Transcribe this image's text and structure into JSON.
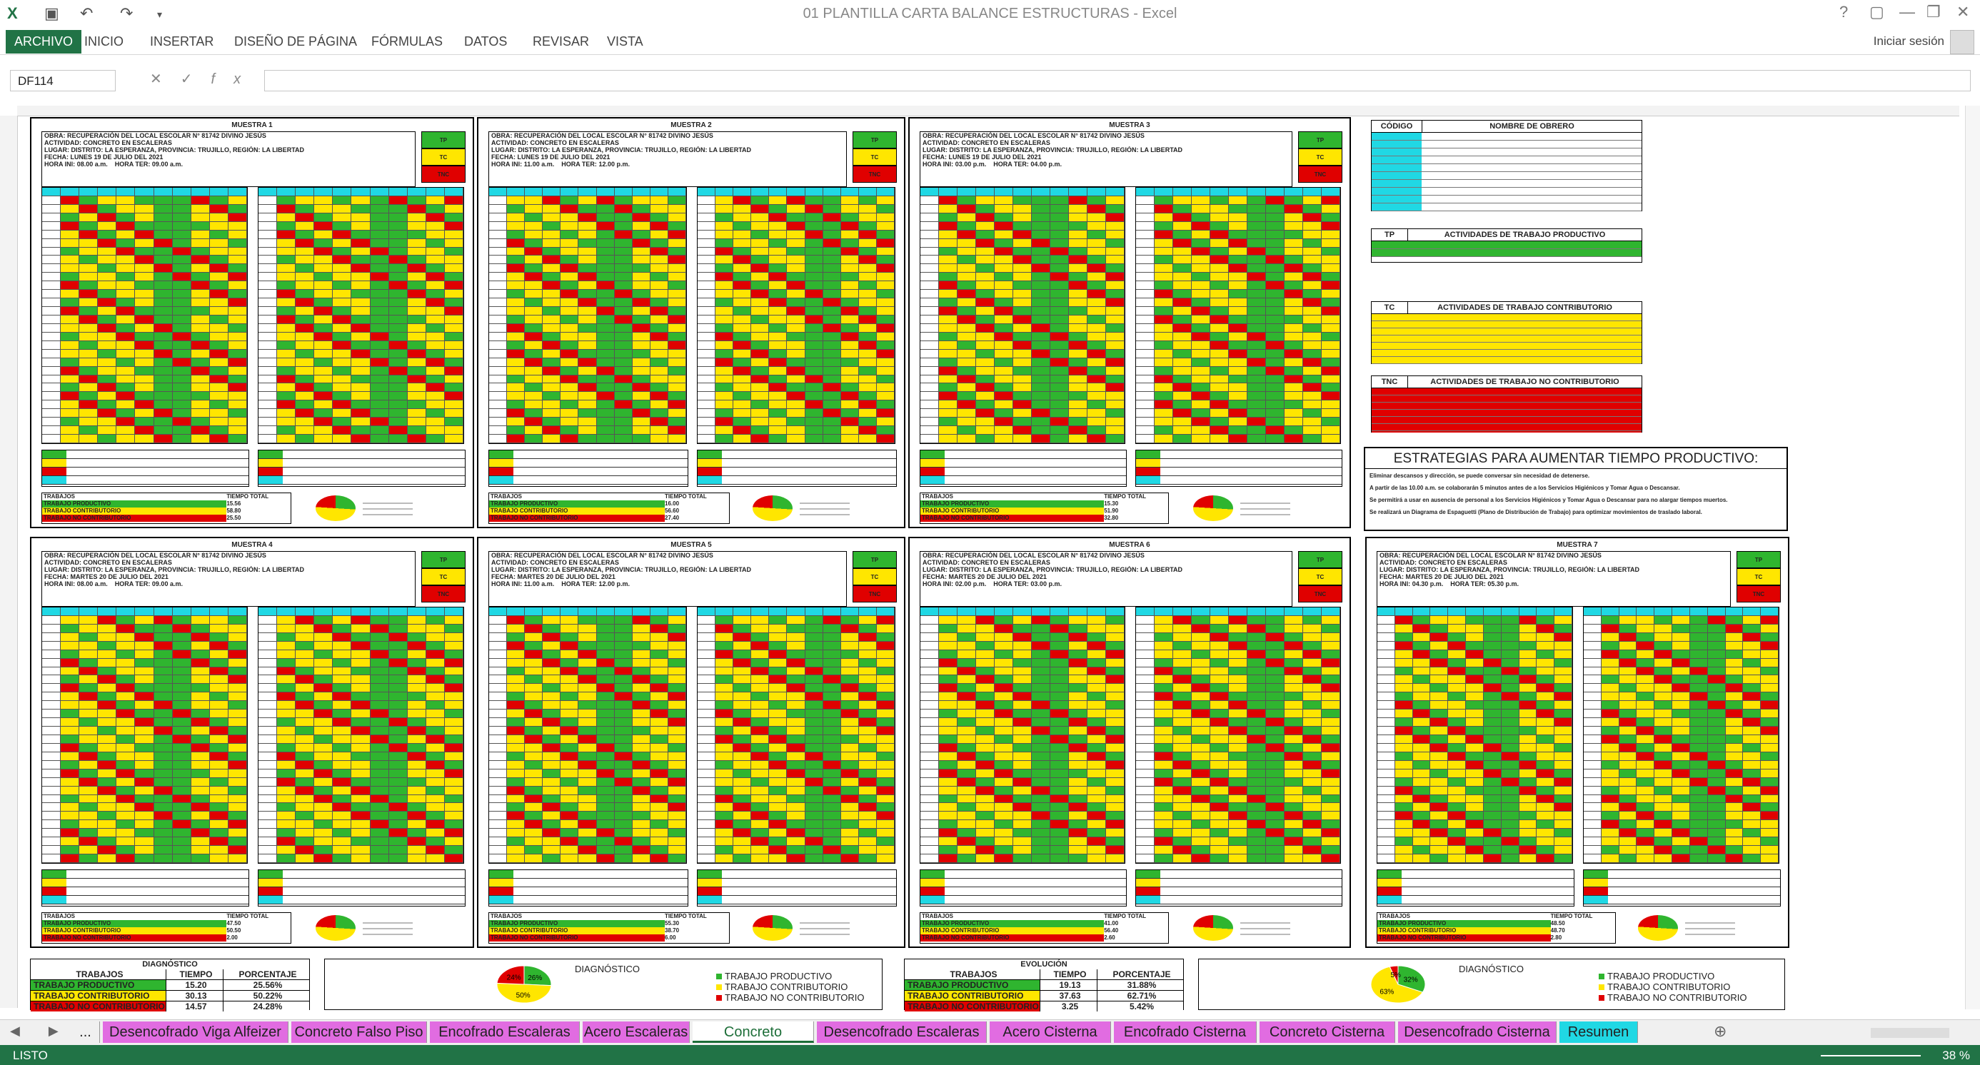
{
  "window": {
    "title": "01 PLANTILLA CARTA BALANCE ESTRUCTURAS - Excel",
    "controls": [
      "?",
      "▢",
      "—",
      "❐",
      "✕"
    ]
  },
  "ribbon": {
    "tabs": [
      "ARCHIVO",
      "INICIO",
      "INSERTAR",
      "DISEÑO DE PÁGINA",
      "FÓRMULAS",
      "DATOS",
      "REVISAR",
      "VISTA"
    ],
    "signin": "Iniciar sesión"
  },
  "formula_bar": {
    "name_box": "DF114",
    "fx": "fx",
    "value": ""
  },
  "samples": [
    {
      "title": "MUESTRA 1",
      "x": 0,
      "fecha": "LUNES 19 DE JULIO DEL 2021",
      "hora_ini": "08.00 a.m.",
      "hora_ter": "09.00 a.m.",
      "prod": "15.56",
      "cont": "58.80",
      "nocont": "25.50"
    },
    {
      "title": "MUESTRA 2",
      "fecha": "LUNES 19 DE JULIO DEL 2021",
      "hora_ini": "11.00 a.m.",
      "hora_ter": "12.00 p.m.",
      "prod": "16.00",
      "cont": "56.60",
      "nocont": "27.40"
    },
    {
      "title": "MUESTRA 3",
      "fecha": "LUNES 19 DE JULIO DEL 2021",
      "hora_ini": "03.00 p.m.",
      "hora_ter": "04.00 p.m.",
      "prod": "15.30",
      "cont": "51.90",
      "nocont": "32.80"
    },
    {
      "title": "MUESTRA 4",
      "fecha": "MARTES 20 DE JULIO DEL 2021",
      "hora_ini": "08.00 a.m.",
      "hora_ter": "09.00 a.m.",
      "prod": "47.50",
      "cont": "50.50",
      "nocont": "2.00"
    },
    {
      "title": "MUESTRA 5",
      "fecha": "MARTES 20 DE JULIO DEL 2021",
      "hora_ini": "11.00 a.m.",
      "hora_ter": "12.00 p.m.",
      "prod": "55.30",
      "cont": "38.70",
      "nocont": "6.00"
    },
    {
      "title": "MUESTRA 6",
      "fecha": "MARTES 20 DE JULIO DEL 2021",
      "hora_ini": "02.00 p.m.",
      "hora_ter": "03.00 p.m.",
      "prod": "41.00",
      "cont": "56.40",
      "nocont": "2.60"
    },
    {
      "title": "MUESTRA 7",
      "fecha": "MARTES 20 DE JULIO DEL 2021",
      "hora_ini": "04.30 p.m.",
      "hora_ter": "05.30 p.m.",
      "prod": "48.50",
      "cont": "48.70",
      "nocont": "2.80"
    }
  ],
  "info_labels": {
    "obra": "OBRA:",
    "actividad": "ACTIVIDAD:",
    "lugar": "LUGAR:",
    "fecha": "FECHA:",
    "hora_ini": "HORA INI:",
    "hora_ter": "HORA TER:",
    "obra_val": "RECUPERACIÓN DEL LOCAL ESCOLAR N° 81742 DIVINO JESÚS",
    "actividad_val": "CONCRETO EN ESCALERAS",
    "lugar_val": "DISTRITO: LA ESPERANZA, PROVINCIA: TRUJILLO, REGIÓN: LA LIBERTAD"
  },
  "categories": {
    "tp": "TP",
    "tc": "TC",
    "tnc": "TNC"
  },
  "summary_labels": {
    "trabajos": "TRABAJOS",
    "tiempo_total": "TIEMPO TOTAL",
    "productivo": "TRABAJO PRODUCTIVO",
    "contributorio": "TRABAJO CONTRIBUTORIO",
    "no_contributorio": "TRABAJO NO CONTRIBUTORIO"
  },
  "legend": {
    "codigo": "CÓDIGO",
    "nombre": "NOMBRE DE OBRERO",
    "tp_title": "ACTIVIDADES DE TRABAJO PRODUCTIVO",
    "tc_title": "ACTIVIDADES DE TRABAJO CONTRIBUTORIO",
    "tnc_title": "ACTIVIDADES DE TRABAJO NO CONTRIBUTORIO"
  },
  "strategies": {
    "title": "ESTRATEGIAS PARA AUMENTAR TIEMPO PRODUCTIVO:",
    "lines": [
      "Eliminar descansos y dirección, se puede conversar sin necesidad de detenerse.",
      "A partir de las 10.00 a.m. se colaborarán 5 minutos antes de a los Servicios Higiénicos y Tomar Agua o Descansar.",
      "Se permitirá a usar en ausencia de personal a los Servicios Higiénicos y Tomar Agua o Descansar para no alargar tiempos muertos.",
      "Se realizará un Diagrama de Espaguetti (Plano de Distribución de Trabajo) para optimizar movimientos de traslado laboral."
    ]
  },
  "diagnostico1": {
    "title": "DIAGNÓSTICO",
    "headers": [
      "TRABAJOS",
      "TIEMPO",
      "PORCENTAJE"
    ],
    "rows": [
      {
        "label": "TRABAJO PRODUCTIVO",
        "tiempo": "15.20",
        "pct": "25.56%"
      },
      {
        "label": "TRABAJO CONTRIBUTORIO",
        "tiempo": "30.13",
        "pct": "50.22%"
      },
      {
        "label": "TRABAJO NO CONTRIBUTORIO",
        "tiempo": "14.57",
        "pct": "24.28%"
      }
    ]
  },
  "evolucion": {
    "title": "EVOLUCIÓN",
    "headers": [
      "TRABAJOS",
      "TIEMPO",
      "PORCENTAJE"
    ],
    "rows": [
      {
        "label": "TRABAJO PRODUCTIVO",
        "tiempo": "19.13",
        "pct": "31.88%"
      },
      {
        "label": "TRABAJO CONTRIBUTORIO",
        "tiempo": "37.63",
        "pct": "62.71%"
      },
      {
        "label": "TRABAJO NO CONTRIBUTORIO",
        "tiempo": "3.25",
        "pct": "5.42%"
      }
    ]
  },
  "chart_data": [
    {
      "type": "pie",
      "title": "DIAGNÓSTICO",
      "categories": [
        "TRABAJO PRODUCTIVO",
        "TRABAJO CONTRIBUTORIO",
        "TRABAJO NO CONTRIBUTORIO"
      ],
      "values": [
        26,
        50,
        24
      ],
      "labels": [
        "26%",
        "50%",
        "24%"
      ]
    },
    {
      "type": "pie",
      "title": "DIAGNÓSTICO",
      "categories": [
        "TRABAJO PRODUCTIVO",
        "TRABAJO CONTRIBUTORIO",
        "TRABAJO NO CONTRIBUTORIO"
      ],
      "values": [
        32,
        63,
        5
      ],
      "labels": [
        "32%",
        "63%",
        "5%"
      ]
    }
  ],
  "colors": {
    "tp": "#2fb52f",
    "tc": "#ffe600",
    "tnc": "#e00000",
    "cyan": "#20d8e4",
    "excel_green": "#217346"
  },
  "sheet_tabs": [
    {
      "label": "...",
      "active": false
    },
    {
      "label": "Desencofrado Viga Alfeizer",
      "active": false
    },
    {
      "label": "Concreto Falso Piso",
      "active": false
    },
    {
      "label": "Encofrado Escaleras",
      "active": false
    },
    {
      "label": "Acero Escaleras",
      "active": false
    },
    {
      "label": "Concreto Escaleras",
      "active": true
    },
    {
      "label": "Desencofrado Escaleras",
      "active": false
    },
    {
      "label": "Acero Cisterna",
      "active": false
    },
    {
      "label": "Encofrado Cisterna",
      "active": false
    },
    {
      "label": "Concreto Cisterna",
      "active": false
    },
    {
      "label": "Desencofrado Cisterna",
      "active": false
    },
    {
      "label": "Resumen",
      "active": false
    }
  ],
  "status": {
    "text": "LISTO",
    "zoom": "38 %"
  }
}
